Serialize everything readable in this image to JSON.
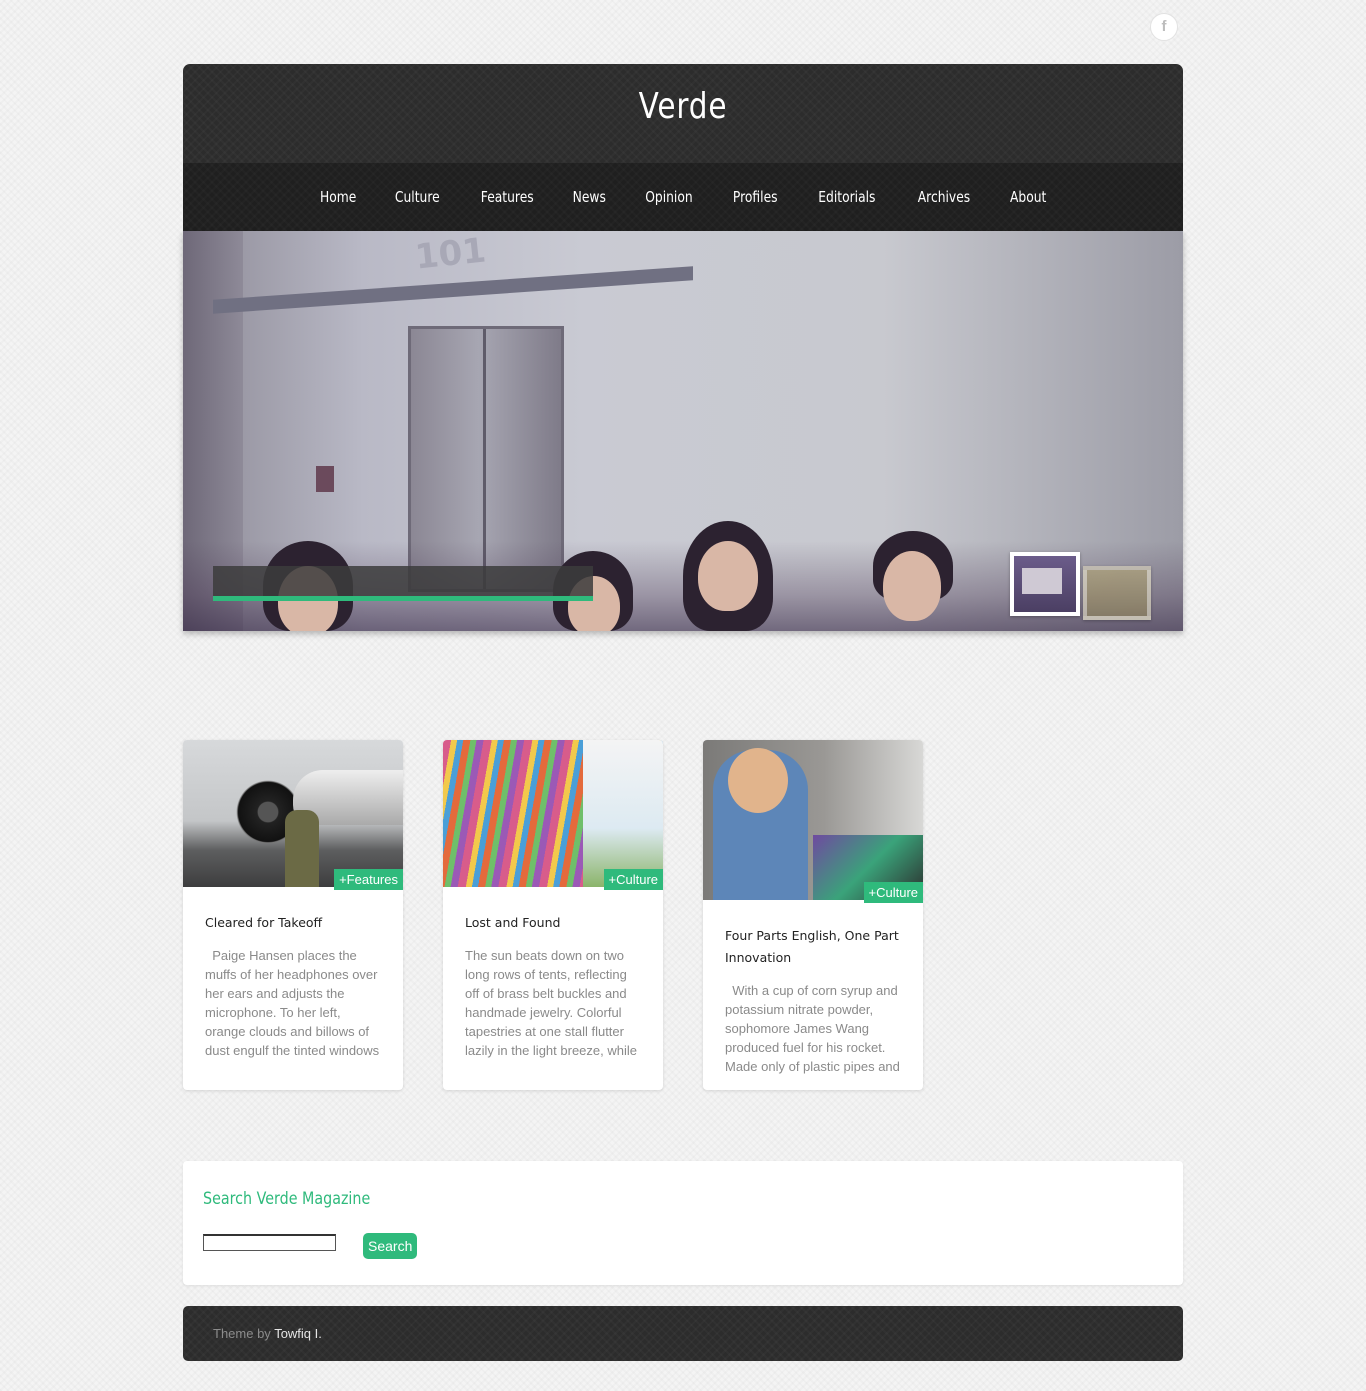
{
  "social": {
    "facebook_icon": "f"
  },
  "site": {
    "title": "Verde"
  },
  "nav": {
    "items": [
      "Home",
      "Culture",
      "Features",
      "News",
      "Opinion",
      "Profiles",
      "Editorials",
      "Archives",
      "About"
    ]
  },
  "slider": {
    "sign_text": "101",
    "accent_color": "#2fba7c"
  },
  "posts": [
    {
      "title": "Cleared for Takeoff",
      "category": "+Features",
      "excerpt": "  Paige Hansen places the muffs of her headphones over her ears and adjusts the microphone. To her left, orange clouds and billows of dust engulf the tinted windows"
    },
    {
      "title": "Lost and Found",
      "category": "+Culture",
      "excerpt": "The sun beats down on two long rows of tents, reflecting off of brass belt buckles and handmade jewelry. Colorful tapestries at one stall flutter lazily in the light breeze, while"
    },
    {
      "title": "Four Parts English, One Part Innovation",
      "category": "+Culture",
      "excerpt": "  With a cup of corn syrup and potassium nitrate powder, sophomore James Wang produced fuel for his rocket. Made only of plastic pipes and"
    }
  ],
  "search": {
    "title": "Search Verde Magazine",
    "input_value": "",
    "button_label": "Search"
  },
  "footer": {
    "prefix": "Theme by ",
    "author_link": "Towfiq I."
  }
}
